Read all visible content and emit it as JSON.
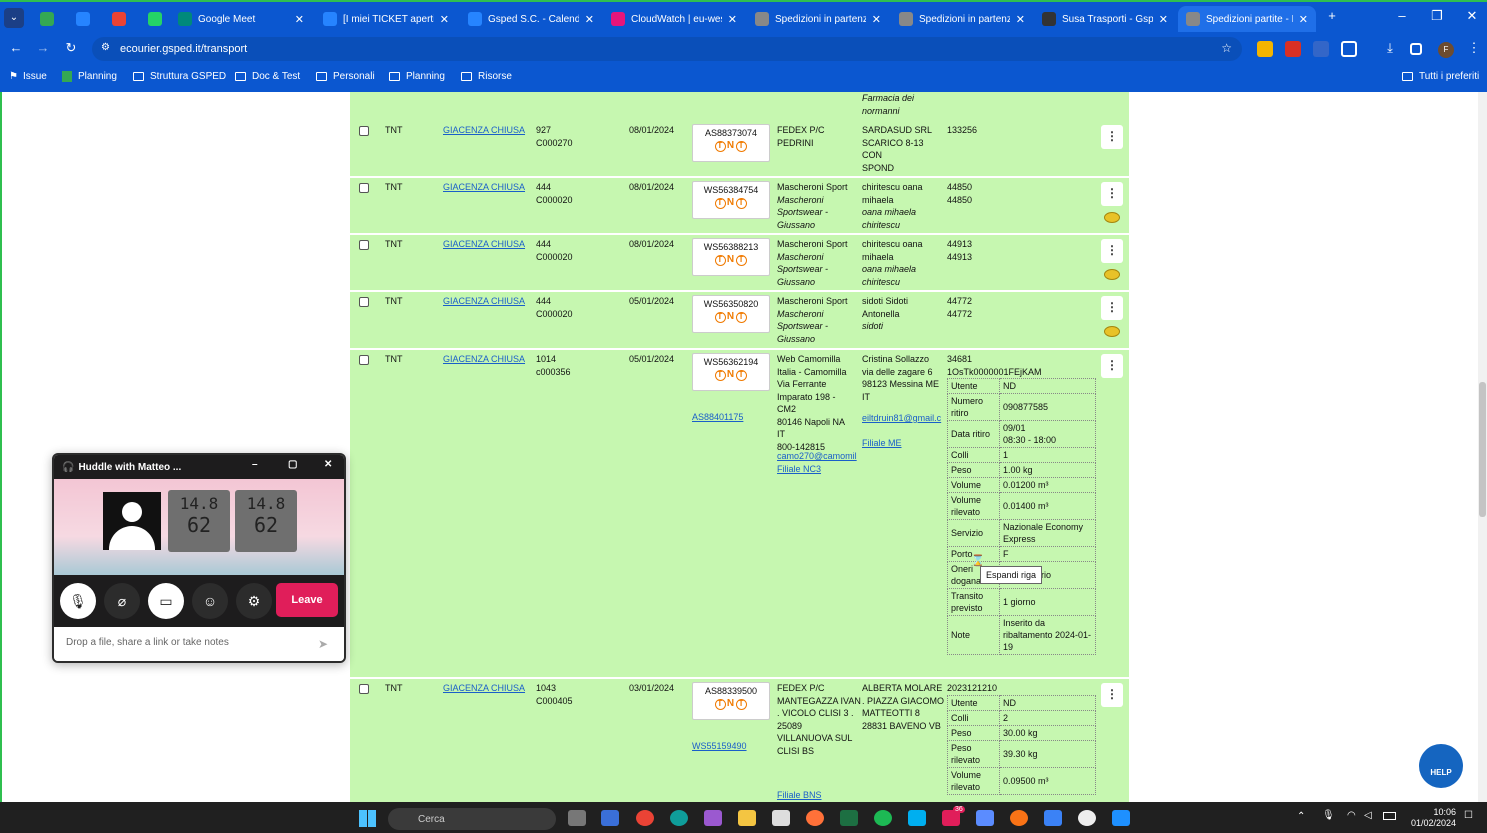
{
  "browser": {
    "tabs": [
      {
        "label": "",
        "icon": "sheets-icon",
        "color": "#34a853"
      },
      {
        "label": "",
        "icon": "trello-icon",
        "color": "#2684ff"
      },
      {
        "label": "",
        "icon": "gmail-icon",
        "color": "#ea4335"
      },
      {
        "label": "",
        "icon": "whatsapp-icon",
        "color": "#25d366"
      },
      {
        "label": "Google Meet",
        "icon": "meet-icon",
        "color": "#00897b"
      },
      {
        "label": "[I miei TICKET aperti]",
        "icon": "jira-icon",
        "color": "#2684ff"
      },
      {
        "label": "Gsped S.C. - Calenda",
        "icon": "trello-icon",
        "color": "#2684ff"
      },
      {
        "label": "CloudWatch | eu-wes",
        "icon": "aws-icon",
        "color": "#e7157b"
      },
      {
        "label": "Spedizioni in partenz",
        "icon": "globe-icon",
        "color": "#888888"
      },
      {
        "label": "Spedizioni in partenz",
        "icon": "globe-icon",
        "color": "#888888"
      },
      {
        "label": "Susa Trasporti - Gspe",
        "icon": "globe-icon",
        "color": "#333333"
      },
      {
        "label": "Spedizioni partite - E",
        "icon": "globe-icon",
        "color": "#888888"
      }
    ],
    "url": "ecourier.gsped.it/transport",
    "bookmarks": [
      "Issue",
      "Planning",
      "Struttura GSPED",
      "Doc & Test",
      "Personali",
      "Planning",
      "Risorse"
    ],
    "all_bookmarks": "Tutti i preferiti"
  },
  "top_fragment": [
    "Farmacia dei",
    "normanni"
  ],
  "rows": [
    {
      "carrier": "TNT",
      "status": "GIACENZA CHIUSA",
      "code1": "927",
      "code2": "C000270",
      "date": "08/01/2024",
      "tracking": "AS88373074",
      "tracking_link": "",
      "sender": [
        "FEDEX P/C PEDRINI"
      ],
      "receiver": [
        "SARDASUD SRL",
        "SCARICO 8-13 CON",
        "SPOND"
      ],
      "ref": [
        "133256"
      ]
    },
    {
      "carrier": "TNT",
      "status": "GIACENZA CHIUSA",
      "code1": "444",
      "code2": "C000020",
      "date": "08/01/2024",
      "tracking": "WS56384754",
      "tracking_link": "",
      "sender": [
        "Mascheroni Sport",
        "Mascheroni",
        "Sportswear -",
        "Giussano"
      ],
      "receiver": [
        "chiritescu oana",
        "mihaela",
        "oana mihaela",
        "chiritescu"
      ],
      "ref": [
        "44850",
        "44850"
      ]
    },
    {
      "carrier": "TNT",
      "status": "GIACENZA CHIUSA",
      "code1": "444",
      "code2": "C000020",
      "date": "08/01/2024",
      "tracking": "WS56388213",
      "tracking_link": "",
      "sender": [
        "Mascheroni Sport",
        "Mascheroni",
        "Sportswear -",
        "Giussano"
      ],
      "receiver": [
        "chiritescu oana",
        "mihaela",
        "oana mihaela",
        "chiritescu"
      ],
      "ref": [
        "44913",
        "44913"
      ]
    },
    {
      "carrier": "TNT",
      "status": "GIACENZA CHIUSA",
      "code1": "444",
      "code2": "C000020",
      "date": "05/01/2024",
      "tracking": "WS56350820",
      "tracking_link": "",
      "sender": [
        "Mascheroni Sport",
        "Mascheroni",
        "Sportswear -",
        "Giussano"
      ],
      "receiver": [
        "sidoti Sidoti",
        "Antonella",
        "sidoti"
      ],
      "ref": [
        "44772",
        "44772"
      ]
    },
    {
      "carrier": "TNT",
      "status": "GIACENZA CHIUSA",
      "code1": "1014",
      "code2": "c000356",
      "date": "05/01/2024",
      "tracking": "WS56362194",
      "tracking_link": "AS88401175",
      "sender": [
        "Web Camomilla",
        "Italia - Camomilla",
        "Via Ferrante",
        "Imparato 198 -",
        "CM2",
        "80146 Napoli NA",
        "IT",
        "800-142815"
      ],
      "sender_email": "camo270@camomil",
      "sender_branch": "Filiale NC3",
      "receiver": [
        "Cristina Sollazzo",
        "via delle zagare 6",
        "98123 Messina ME",
        "IT"
      ],
      "receiver_email": "eiltdruin81@gmail.c",
      "receiver_branch": "Filiale ME",
      "ref": [
        "34681",
        "1OsTk0000001FEjKAM"
      ]
    },
    {
      "carrier": "TNT",
      "status": "GIACENZA CHIUSA",
      "code1": "1043",
      "code2": "C000405",
      "date": "03/01/2024",
      "tracking": "AS88339500",
      "tracking_link": "WS55159490",
      "sender": [
        "FEDEX P/C",
        "MANTEGAZZA IVAN",
        ". VICOLO CLISI 3 .",
        "25089",
        "VILLANUOVA SUL",
        "CLISI BS"
      ],
      "sender_branch": "Filiale BNS",
      "receiver": [
        "ALBERTA MOLARE",
        ". PIAZZA GIACOMO",
        "MATTEOTTI 8",
        "28831 BAVENO VB"
      ],
      "ref": [
        "2023121210"
      ]
    }
  ],
  "details1": [
    [
      "Utente",
      "ND"
    ],
    [
      "Numero ritiro",
      "090877585"
    ],
    [
      "Data ritiro",
      "09/01\n08:30 - 18:00"
    ],
    [
      "Colli",
      "1"
    ],
    [
      "Peso",
      "1.00 kg"
    ],
    [
      "Volume",
      "0.01200 m³"
    ],
    [
      "Volume rilevato",
      "0.01400 m³"
    ],
    [
      "Servizio",
      "Nazionale Economy Express"
    ],
    [
      "Porto",
      "F"
    ],
    [
      "Oneri doganali",
      "Destinatario"
    ],
    [
      "Transito previsto",
      "1 giorno"
    ],
    [
      "Note",
      "Inserito da ribaltamento 2024-01-19"
    ]
  ],
  "details2": [
    [
      "Utente",
      "ND"
    ],
    [
      "Colli",
      "2"
    ],
    [
      "Peso",
      "30.00 kg"
    ],
    [
      "Peso rilevato",
      "39.30 kg"
    ],
    [
      "Volume rilevato",
      "0.09500 m³"
    ]
  ],
  "tooltip": "Espandi riga",
  "huddle": {
    "title": "Huddle with Matteo ...",
    "leave": "Leave",
    "note_placeholder": "Drop a file, share a link or take notes",
    "thermo_top": "14.8",
    "thermo_bottom": "62"
  },
  "help_label": "HELP",
  "taskbar": {
    "search": "Cerca",
    "time": "10:06",
    "date": "01/02/2024",
    "badge": "36"
  }
}
